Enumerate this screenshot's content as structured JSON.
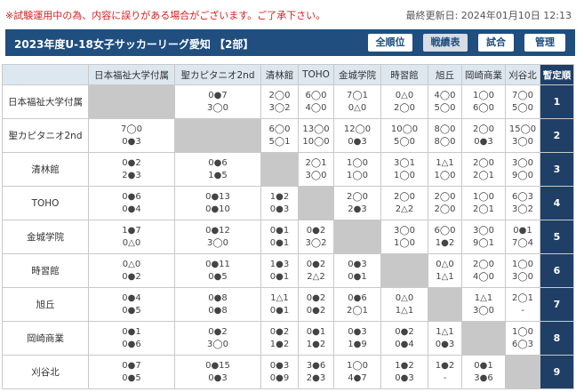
{
  "notice": "※試験運用中の為、内容に誤りがある場合がございます。ご了承下さい。",
  "last_updated": "最終更新日: 2024年01月10日 12:13",
  "header": {
    "title": "2023年度U-18女子サッカーリーグ愛知 【2部】",
    "tabs": [
      {
        "label": "全順位",
        "active": false
      },
      {
        "label": "戦績表",
        "active": true
      },
      {
        "label": "試合",
        "active": false
      },
      {
        "label": "管理",
        "active": false
      }
    ]
  },
  "table": {
    "teams": [
      "日本福祉大学付属",
      "聖カピタニオ2nd",
      "清林館",
      "TOHO",
      "金城学院",
      "時習館",
      "旭丘",
      "岡崎商業",
      "刈谷北"
    ],
    "rank_header": "暫定順",
    "rows": [
      {
        "team": "日本福祉大学付属",
        "rank": "1",
        "cells": [
          null,
          [
            "0●7",
            "3◯0"
          ],
          [
            "2◯0",
            "3◯2"
          ],
          [
            "6◯0",
            "4◯0"
          ],
          [
            "7◯1",
            "0△0"
          ],
          [
            "0△0",
            "2◯0"
          ],
          [
            "4◯0",
            "5◯0"
          ],
          [
            "1◯0",
            "6◯0"
          ],
          [
            "7◯0",
            "5◯0"
          ]
        ]
      },
      {
        "team": "聖カピタニオ2nd",
        "rank": "2",
        "cells": [
          [
            "7◯0",
            "0●3"
          ],
          null,
          [
            "6◯0",
            "5◯1"
          ],
          [
            "13◯0",
            "10◯0"
          ],
          [
            "12◯0",
            "0●3"
          ],
          [
            "10◯0",
            "5◯0"
          ],
          [
            "8◯0",
            "8◯0"
          ],
          [
            "2◯0",
            "0●3"
          ],
          [
            "15◯0",
            "3◯0"
          ]
        ]
      },
      {
        "team": "清林館",
        "rank": "3",
        "cells": [
          [
            "0●2",
            "2●3"
          ],
          [
            "0●6",
            "1●5"
          ],
          null,
          [
            "2◯1",
            "3◯0"
          ],
          [
            "1◯0",
            "1◯0"
          ],
          [
            "3◯1",
            "1◯0"
          ],
          [
            "1△1",
            "1◯0"
          ],
          [
            "2◯0",
            "2◯1"
          ],
          [
            "3◯0",
            "9◯0"
          ]
        ]
      },
      {
        "team": "TOHO",
        "rank": "4",
        "cells": [
          [
            "0●6",
            "0●4"
          ],
          [
            "0●13",
            "0●10"
          ],
          [
            "1●2",
            "0●3"
          ],
          null,
          [
            "2◯0",
            "2●3"
          ],
          [
            "2◯0",
            "2△2"
          ],
          [
            "2◯0",
            "2◯0"
          ],
          [
            "1◯0",
            "2◯1"
          ],
          [
            "6◯3",
            "3◯2"
          ]
        ]
      },
      {
        "team": "金城学院",
        "rank": "5",
        "cells": [
          [
            "1●7",
            "0△0"
          ],
          [
            "0●12",
            "3◯0"
          ],
          [
            "0●1",
            "0●1"
          ],
          [
            "0●2",
            "3◯2"
          ],
          null,
          [
            "3◯0",
            "1◯0"
          ],
          [
            "6◯0",
            "1●2"
          ],
          [
            "3◯0",
            "9◯1"
          ],
          [
            "0●1",
            "7◯4"
          ]
        ]
      },
      {
        "team": "時習館",
        "rank": "6",
        "cells": [
          [
            "0△0",
            "0●2"
          ],
          [
            "0●11",
            "0●5"
          ],
          [
            "1●3",
            "0●1"
          ],
          [
            "0●2",
            "2△2"
          ],
          [
            "0●3",
            "0●1"
          ],
          null,
          [
            "0△0",
            "1△1"
          ],
          [
            "2◯0",
            "4◯0"
          ],
          [
            "1◯0",
            "3◯0"
          ]
        ]
      },
      {
        "team": "旭丘",
        "rank": "7",
        "cells": [
          [
            "0●4",
            "0●5"
          ],
          [
            "0●8",
            "0●8"
          ],
          [
            "1△1",
            "0●1"
          ],
          [
            "0●2",
            "0●2"
          ],
          [
            "0●6",
            "2◯1"
          ],
          [
            "0△0",
            "1△1"
          ],
          null,
          [
            "1△1",
            "3◯0"
          ],
          [
            "2◯1",
            "-"
          ]
        ]
      },
      {
        "team": "岡崎商業",
        "rank": "8",
        "cells": [
          [
            "0●1",
            "0●6"
          ],
          [
            "0●2",
            "3◯0"
          ],
          [
            "0●2",
            "1●2"
          ],
          [
            "0●1",
            "1●2"
          ],
          [
            "0●3",
            "1●9"
          ],
          [
            "0●2",
            "0●4"
          ],
          [
            "1△1",
            "0●3"
          ],
          null,
          [
            "1◯0",
            "6◯3"
          ]
        ]
      },
      {
        "team": "刈谷北",
        "rank": "9",
        "cells": [
          [
            "0●7",
            "0●5"
          ],
          [
            "0●15",
            "0●3"
          ],
          [
            "0●3",
            "0●9"
          ],
          [
            "3●6",
            "2●3"
          ],
          [
            "1◯0",
            "4●7"
          ],
          [
            "1●2",
            "0●3"
          ],
          [
            "1●2",
            "-"
          ],
          [
            "0●1",
            "3●6"
          ],
          null
        ]
      }
    ]
  }
}
